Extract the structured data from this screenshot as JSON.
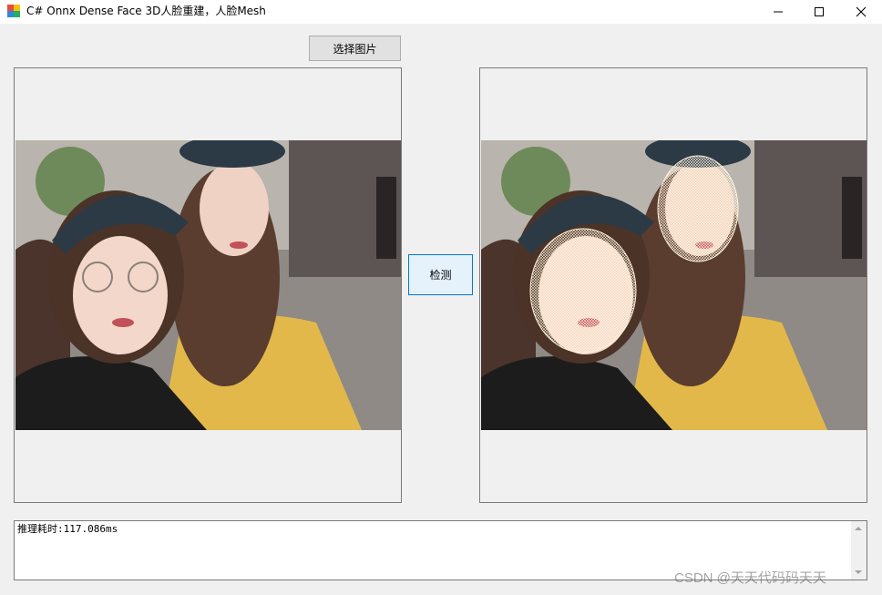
{
  "window": {
    "title": "C# Onnx  Dense Face 3D人脸重建，人脸Mesh",
    "icon": "app-form-icon"
  },
  "buttons": {
    "select_image": "选择图片",
    "detect": "检测"
  },
  "output": {
    "text": "推理耗时:117.086ms"
  },
  "watermark": "CSDN @天天代码码天天",
  "colors": {
    "accent_border": "#0078d7",
    "mesh": "#fff3dc",
    "cap": "#2c3a45",
    "top": "#e3b84a"
  },
  "icons": [
    "minimize-icon",
    "maximize-icon",
    "close-icon",
    "scroll-up-icon",
    "scroll-down-icon"
  ]
}
